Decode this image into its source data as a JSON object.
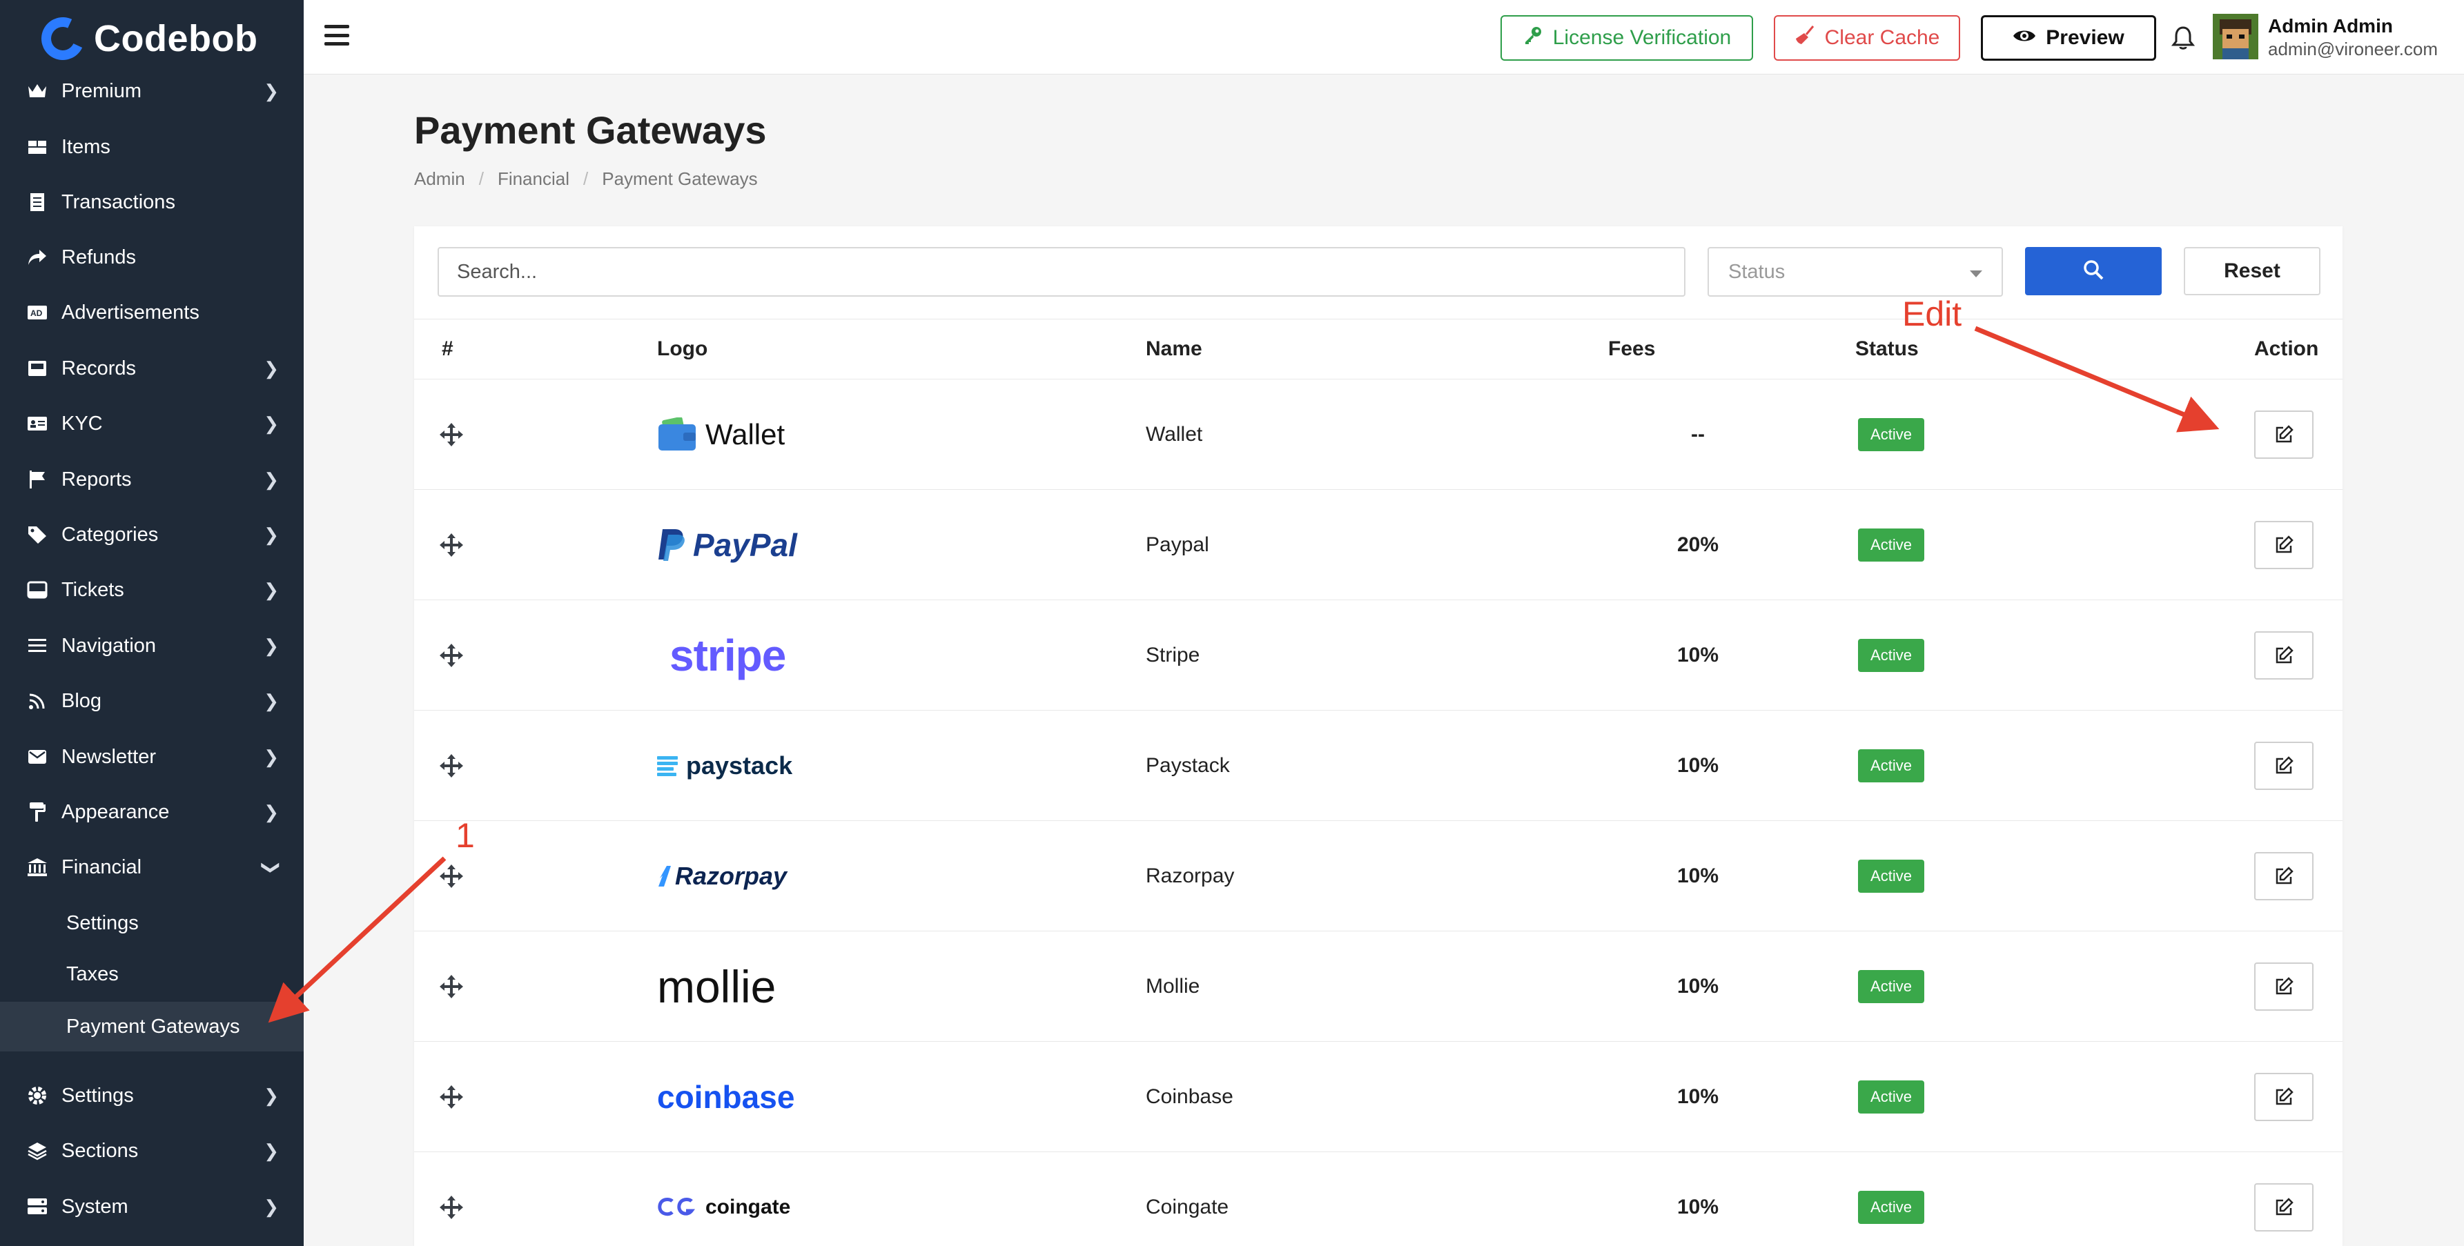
{
  "app": {
    "logo_text": "Codebob"
  },
  "sidebar": {
    "items": [
      {
        "label": "Premium",
        "icon": "crown-icon",
        "has_chevron": true
      },
      {
        "label": "Items",
        "icon": "boxes-icon",
        "has_chevron": false
      },
      {
        "label": "Transactions",
        "icon": "receipt-icon",
        "has_chevron": false
      },
      {
        "label": "Refunds",
        "icon": "share-icon",
        "has_chevron": false
      },
      {
        "label": "Advertisements",
        "icon": "ad-icon",
        "has_chevron": false
      },
      {
        "label": "Records",
        "icon": "inbox-icon",
        "has_chevron": true
      },
      {
        "label": "KYC",
        "icon": "id-card-icon",
        "has_chevron": true
      },
      {
        "label": "Reports",
        "icon": "flag-icon",
        "has_chevron": true
      },
      {
        "label": "Categories",
        "icon": "tags-icon",
        "has_chevron": true
      },
      {
        "label": "Tickets",
        "icon": "tray-icon",
        "has_chevron": true
      },
      {
        "label": "Navigation",
        "icon": "bars-icon",
        "has_chevron": true
      },
      {
        "label": "Blog",
        "icon": "rss-icon",
        "has_chevron": true
      },
      {
        "label": "Newsletter",
        "icon": "envelope-icon",
        "has_chevron": true
      },
      {
        "label": "Appearance",
        "icon": "paint-roller-icon",
        "has_chevron": true
      },
      {
        "label": "Financial",
        "icon": "bank-icon",
        "has_chevron": true,
        "expanded": true
      }
    ],
    "financial_sub": [
      {
        "label": "Settings"
      },
      {
        "label": "Taxes"
      },
      {
        "label": "Payment Gateways",
        "active": true
      }
    ],
    "bottom_items": [
      {
        "label": "Settings",
        "icon": "gear-icon"
      },
      {
        "label": "Sections",
        "icon": "layers-icon"
      },
      {
        "label": "System",
        "icon": "server-icon"
      }
    ]
  },
  "topbar": {
    "license_label": "License Verification",
    "cache_label": "Clear Cache",
    "preview_label": "Preview",
    "user_name": "Admin Admin",
    "user_email": "admin@vironeer.com"
  },
  "page": {
    "title": "Payment Gateways",
    "breadcrumb": [
      "Admin",
      "Financial",
      "Payment Gateways"
    ]
  },
  "filters": {
    "search_placeholder": "Search...",
    "status_placeholder": "Status",
    "reset_label": "Reset"
  },
  "table": {
    "headers": {
      "num": "#",
      "logo": "Logo",
      "name": "Name",
      "fees": "Fees",
      "status": "Status",
      "action": "Action"
    },
    "rows": [
      {
        "logo": "Wallet",
        "name": "Wallet",
        "fees": "--",
        "status": "Active"
      },
      {
        "logo": "PayPal",
        "name": "Paypal",
        "fees": "20%",
        "status": "Active"
      },
      {
        "logo": "stripe",
        "name": "Stripe",
        "fees": "10%",
        "status": "Active"
      },
      {
        "logo": "paystack",
        "name": "Paystack",
        "fees": "10%",
        "status": "Active"
      },
      {
        "logo": "Razorpay",
        "name": "Razorpay",
        "fees": "10%",
        "status": "Active"
      },
      {
        "logo": "mollie",
        "name": "Mollie",
        "fees": "10%",
        "status": "Active"
      },
      {
        "logo": "coinbase",
        "name": "Coinbase",
        "fees": "10%",
        "status": "Active"
      },
      {
        "logo": "coingate",
        "name": "Coingate",
        "fees": "10%",
        "status": "Active"
      }
    ]
  },
  "annotations": {
    "edit_label": "Edit",
    "step_label": "1",
    "color": "#e5402e"
  },
  "colors": {
    "sidebar_bg": "#1f2a38",
    "accent": "#2563d6",
    "active_badge": "#3aa84a"
  }
}
